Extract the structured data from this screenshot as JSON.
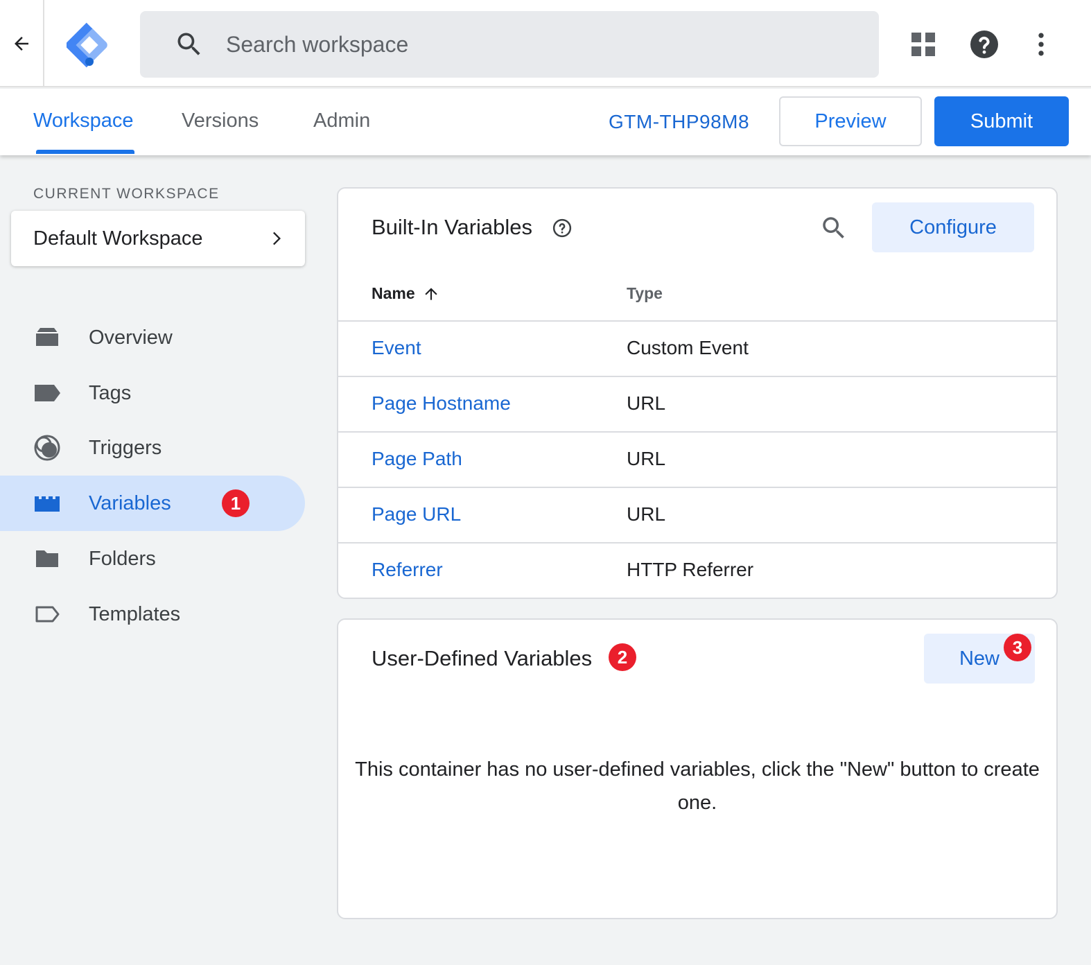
{
  "topbar": {
    "search_placeholder": "Search workspace",
    "icons": [
      "back-arrow-icon",
      "gtm-logo-icon",
      "search-icon",
      "apps-grid-icon",
      "help-icon",
      "more-vert-icon"
    ]
  },
  "tabs": [
    {
      "label": "Workspace",
      "active": true
    },
    {
      "label": "Versions",
      "active": false
    },
    {
      "label": "Admin",
      "active": false
    }
  ],
  "container_id": "GTM-THP98M8",
  "actions": {
    "preview_label": "Preview",
    "submit_label": "Submit"
  },
  "sidebar": {
    "current_workspace_label": "CURRENT WORKSPACE",
    "workspace_name": "Default Workspace",
    "nav": [
      {
        "label": "Overview",
        "icon": "overview-icon",
        "active": false
      },
      {
        "label": "Tags",
        "icon": "tag-icon",
        "active": false
      },
      {
        "label": "Triggers",
        "icon": "trigger-icon",
        "active": false
      },
      {
        "label": "Variables",
        "icon": "variables-icon",
        "active": true,
        "badge": "1"
      },
      {
        "label": "Folders",
        "icon": "folder-icon",
        "active": false
      },
      {
        "label": "Templates",
        "icon": "template-icon",
        "active": false
      }
    ]
  },
  "builtin": {
    "title": "Built-In Variables",
    "configure_label": "Configure",
    "columns": {
      "name": "Name",
      "type": "Type"
    },
    "rows": [
      {
        "name": "Event",
        "type": "Custom Event"
      },
      {
        "name": "Page Hostname",
        "type": "URL"
      },
      {
        "name": "Page Path",
        "type": "URL"
      },
      {
        "name": "Page URL",
        "type": "URL"
      },
      {
        "name": "Referrer",
        "type": "HTTP Referrer"
      }
    ]
  },
  "userdefined": {
    "title": "User-Defined Variables",
    "title_badge": "2",
    "new_label": "New",
    "new_badge": "3",
    "empty_message": "This container has no user-defined variables, click the \"New\" button to create one."
  },
  "colors": {
    "accent": "#1a73e8",
    "link": "#1967d2",
    "badge": "#ea1f2c",
    "active_nav_bg": "#d2e3fc",
    "page_bg": "#f1f3f4"
  }
}
